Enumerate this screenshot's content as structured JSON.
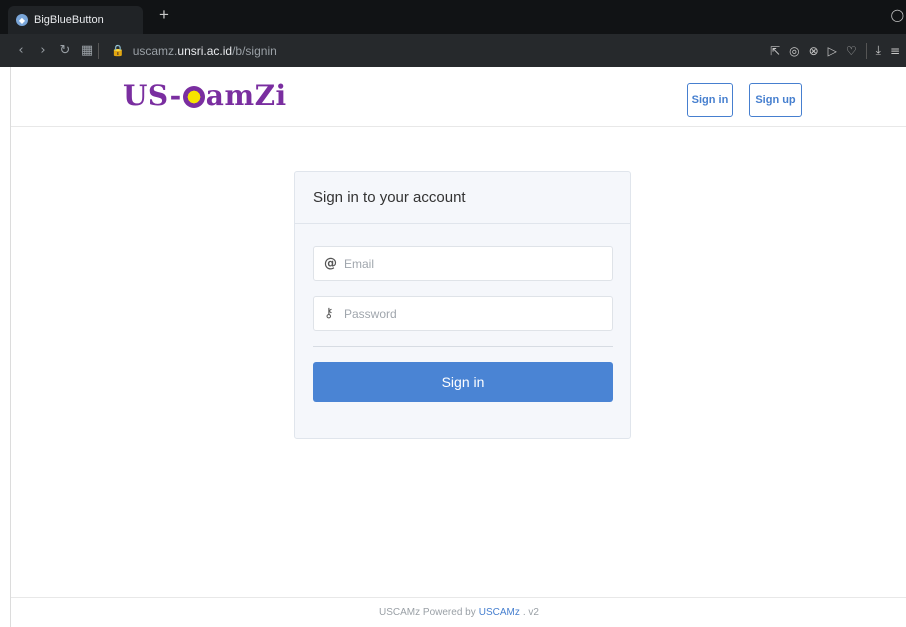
{
  "browser": {
    "tab_title": "BigBlueButton",
    "new_tab_symbol": "+",
    "url_prefix": "uscamz.",
    "url_host": "unsri.ac.id",
    "url_path": "/b/signin",
    "icons": [
      "back-icon",
      "forward-icon",
      "reload-icon",
      "grid-icon",
      "lock-icon",
      "share-icon",
      "camera-icon",
      "shield-icon",
      "send-icon",
      "heart-icon",
      "download-icon",
      "menu-icon"
    ]
  },
  "header": {
    "logo_prefix": "US-",
    "logo_suffix": "amZi",
    "signin_label": "Sign in",
    "signup_label": "Sign up"
  },
  "card": {
    "title": "Sign in to your account",
    "email_placeholder": "Email",
    "password_placeholder": "Password",
    "submit_label": "Sign in"
  },
  "footer": {
    "text": "USCAMz Powered by",
    "link_text": "USCAMz",
    "version": ". v2"
  },
  "colors": {
    "accent": "#467fcf",
    "button": "#4a84d4",
    "logo": "#7a2ea0"
  }
}
